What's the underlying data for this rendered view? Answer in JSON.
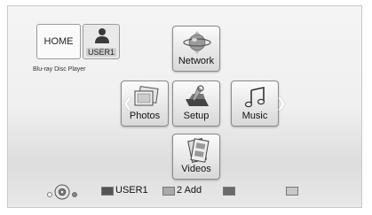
{
  "header": {
    "home_label": "HOME",
    "user_label": "USER1",
    "device_name": "Blu-ray Disc Player"
  },
  "menu": {
    "network": {
      "label": "Network",
      "icon": "globe-icon"
    },
    "photos": {
      "label": "Photos",
      "icon": "photos-icon"
    },
    "setup": {
      "label": "Setup",
      "icon": "toolbox-icon"
    },
    "music": {
      "label": "Music",
      "icon": "music-notes-icon"
    },
    "videos": {
      "label": "Videos",
      "icon": "film-icon"
    }
  },
  "footer": {
    "red_label": "USER1",
    "green_label": "2 Add",
    "yellow_label": "",
    "blue_label": ""
  }
}
